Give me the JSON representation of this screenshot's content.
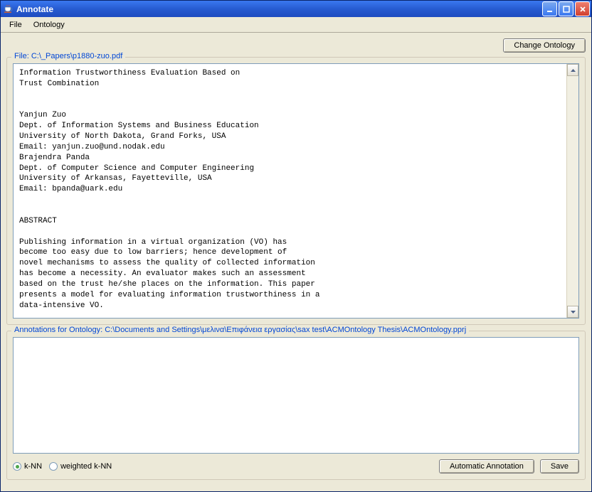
{
  "window": {
    "title": "Annotate"
  },
  "menubar": {
    "items": [
      "File",
      "Ontology"
    ]
  },
  "buttons": {
    "change_ontology": "Change Ontology",
    "automatic_annotation": "Automatic Annotation",
    "save": "Save"
  },
  "file_panel": {
    "legend": "File:  C:\\_Papers\\p1880-zuo.pdf",
    "content": "Information Trustworthiness Evaluation Based on\nTrust Combination\n\n\nYanjun Zuo\nDept. of Information Systems and Business Education\nUniversity of North Dakota, Grand Forks, USA\nEmail: yanjun.zuo@und.nodak.edu\nBrajendra Panda\nDept. of Computer Science and Computer Engineering\nUniversity of Arkansas, Fayetteville, USA\nEmail: bpanda@uark.edu\n\n\nABSTRACT\n\nPublishing information in a virtual organization (VO) has\nbecome too easy due to low barriers; hence development of\nnovel mechanisms to assess the quality of collected information\nhas become a necessity. An evaluator makes such an assessment\nbased on the trust he/she places on the information. This paper\npresents a model for evaluating information trustworthiness in a\ndata-intensive VO.\n\nWhen some information is derived from various data items\ngathered from multiple sources (each data item is called an"
  },
  "annotations_panel": {
    "legend": "Annotations for Ontology:  C:\\Documents and Settings\\μελινα\\Επιφάνεια εργασίας\\sax test\\ACMOntology Thesis\\ACMOntology.pprj"
  },
  "radios": {
    "knn": "k-NN",
    "weighted_knn": "weighted k-NN",
    "selected": "knn"
  }
}
